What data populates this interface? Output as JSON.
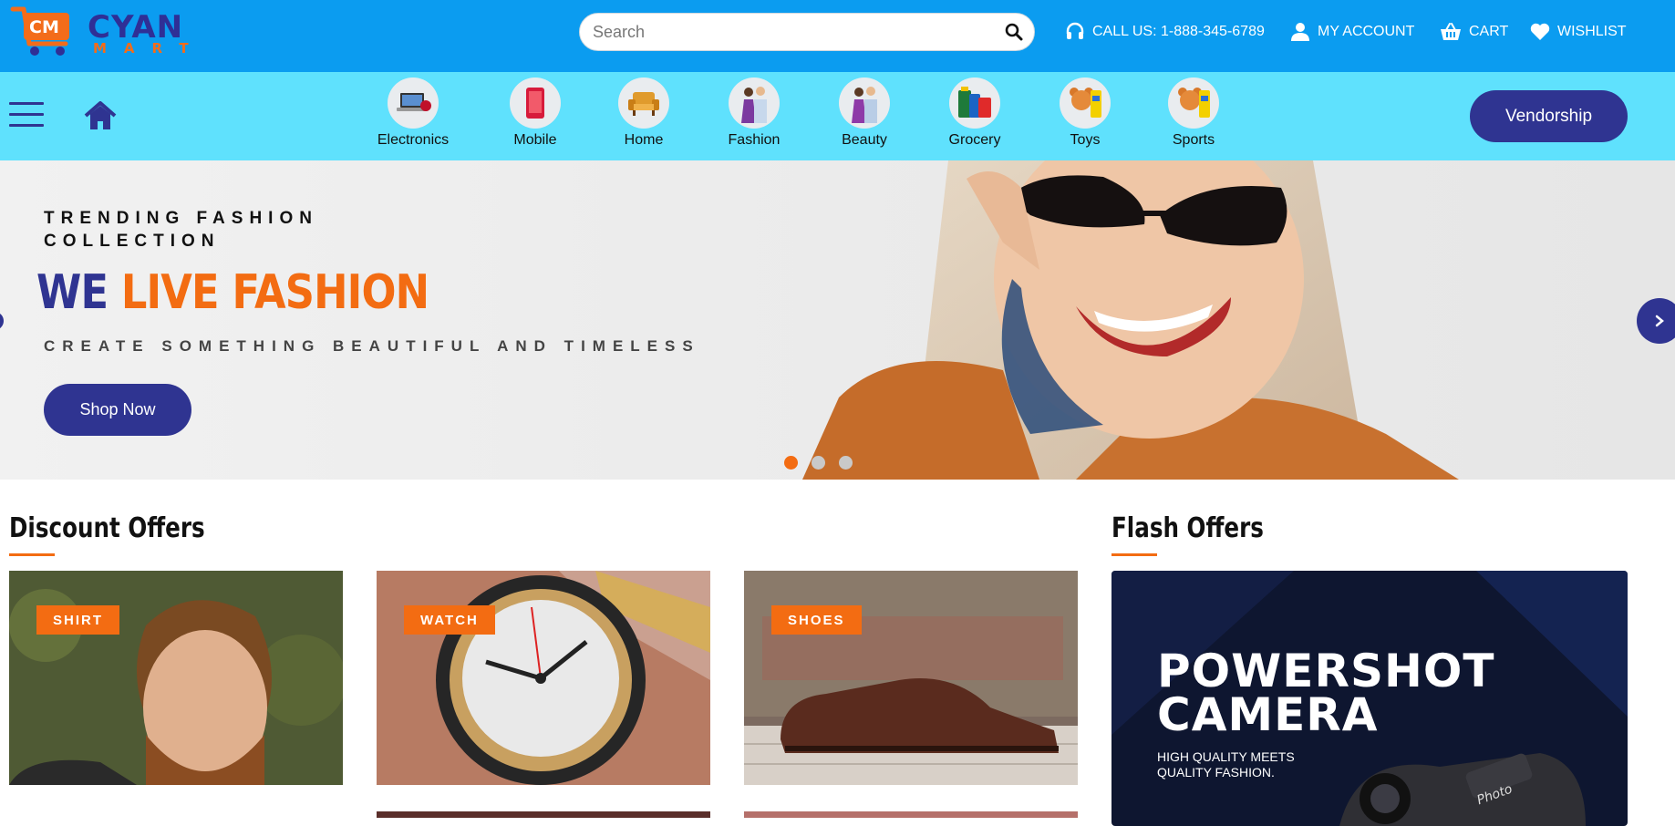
{
  "header": {
    "logo_badge": "CM",
    "logo_word_1": "CYAN",
    "logo_word_2": "MART",
    "search_placeholder": "Search",
    "call": "CALL US: 1-888-345-6789",
    "account": "MY ACCOUNT",
    "cart": "CART",
    "wishlist": "WISHLIST"
  },
  "categories": [
    {
      "label": "Electronics"
    },
    {
      "label": "Mobile"
    },
    {
      "label": "Home"
    },
    {
      "label": "Fashion"
    },
    {
      "label": "Beauty"
    },
    {
      "label": "Grocery"
    },
    {
      "label": "Toys"
    },
    {
      "label": "Sports"
    }
  ],
  "vendorship": "Vendorship",
  "hero": {
    "eyebrow": "TRENDING FASHION COLLECTION",
    "title_1": "WE",
    "title_2": "LIVE FASHION",
    "subtitle": "CREATE SOMETHING BEAUTIFUL AND TIMELESS",
    "button": "Shop Now",
    "active_slide": 1,
    "slide_count": 3
  },
  "discount": {
    "title": "Discount Offers",
    "cards": [
      {
        "badge": "SHIRT"
      },
      {
        "badge": "WATCH"
      },
      {
        "badge": "SHOES"
      }
    ]
  },
  "flash": {
    "title": "Flash Offers",
    "banner_title": "POWERSHOT CAMERA",
    "banner_sub": "HIGH QUALITY MEETS QUALITY FASHION.",
    "camera_brand": "Photo"
  },
  "colors": {
    "header_blue": "#0b9cf0",
    "cat_cyan": "#5fe1fd",
    "navy": "#2f3491",
    "orange": "#f36c12"
  }
}
